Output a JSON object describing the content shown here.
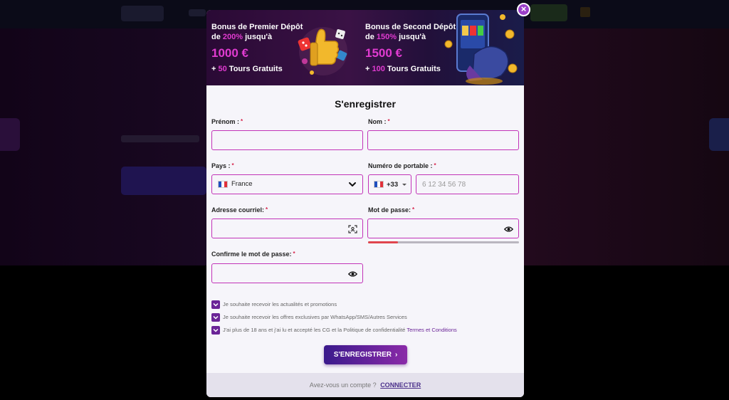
{
  "banner": {
    "bonus1": {
      "line1": "Bonus de Premier Dépôt",
      "line2_pre": "de ",
      "line2_pct": "200%",
      "line2_post": " jusqu'à",
      "amount": "1000 €",
      "spins_pre": "+ ",
      "spins_num": "50",
      "spins_post": " Tours Gratuits"
    },
    "bonus2": {
      "line1": "Bonus de Second Dépôt",
      "line2_pre": "de ",
      "line2_pct": "150%",
      "line2_post": " jusqu'à",
      "amount": "1500 €",
      "spins_pre": "+ ",
      "spins_num": "100",
      "spins_post": " Tours Gratuits"
    }
  },
  "close_label": "×",
  "form": {
    "title": "S'enregistrer",
    "required_mark": "*",
    "prenom_label": "Prénom :",
    "nom_label": "Nom :",
    "pays_label": "Pays :",
    "pays_value": "France",
    "phone_label": "Numéro de portable :",
    "country_code": "+33",
    "phone_placeholder": "6 12 34 56 78",
    "email_label": "Adresse courriel:",
    "password_label": "Mot de passe:",
    "confirm_label": "Confirme le mot de passe:",
    "password_strength": 0.2,
    "check1": "Je souhaite recevoir les actualités et promotions",
    "check2": "Je souhaite recevoir les offres exclusives par WhatsApp/SMS/Autres Services",
    "check3": "J'ai plus de 18 ans et j'ai lu et accepté les CG et la Politique de confidentialité",
    "check3_link": "Termes et Conditions",
    "submit_label": "S'ENREGISTRER",
    "submit_arrow": "›"
  },
  "footer": {
    "question": "Avez-vous un compte ?",
    "link": "CONNECTER"
  },
  "colors": {
    "accent": "#c233b8",
    "purple": "#6a2497",
    "pink": "#e03bd0"
  }
}
